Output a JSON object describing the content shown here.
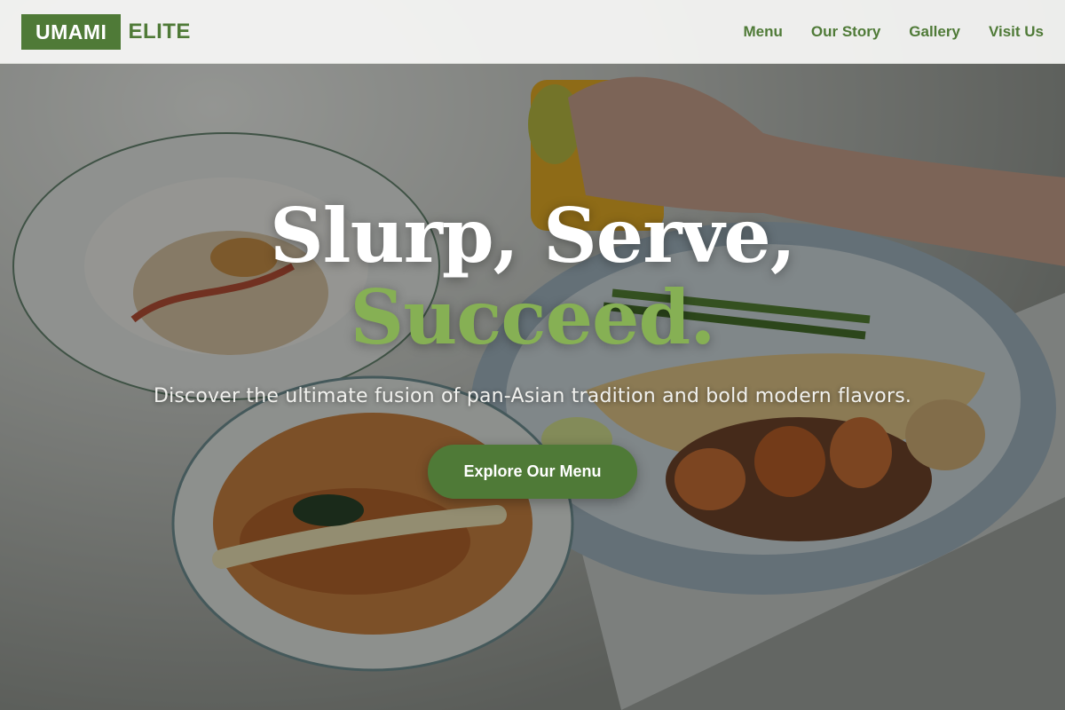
{
  "brand": {
    "logo_box": "UMAMI",
    "logo_text": "ELITE",
    "accent_color": "#4f7a37",
    "highlight_color": "#86b054"
  },
  "nav": {
    "items": [
      {
        "label": "Menu"
      },
      {
        "label": "Our Story"
      },
      {
        "label": "Gallery"
      },
      {
        "label": "Visit Us"
      }
    ]
  },
  "hero": {
    "headline_line1": "Slurp, Serve,",
    "headline_line2": "Succeed.",
    "subtitle": "Discover the ultimate fusion of pan-Asian tradition and bold modern flavors.",
    "cta_label": "Explore Our Menu",
    "background": "food-photo-image"
  }
}
